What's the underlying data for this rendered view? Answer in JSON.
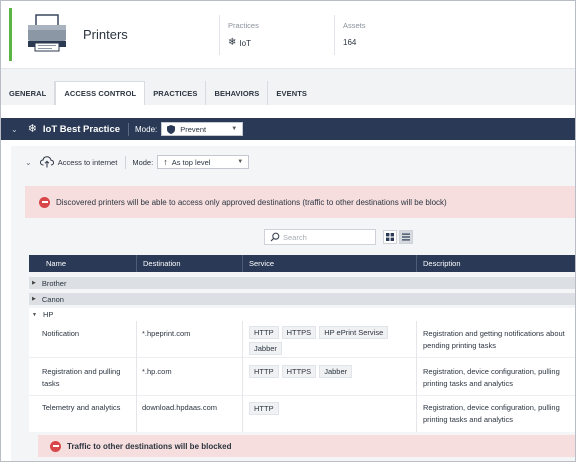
{
  "header": {
    "title": "Printers",
    "practices_label": "Practices",
    "practices_value": "IoT",
    "assets_label": "Assets",
    "assets_value": "164",
    "accent_color": "#5bb544"
  },
  "tabs": [
    {
      "label": "GENERAL",
      "active": false
    },
    {
      "label": "ACCESS CONTROL",
      "active": true
    },
    {
      "label": "PRACTICES",
      "active": false
    },
    {
      "label": "BEHAVIORS",
      "active": false
    },
    {
      "label": "EVENTS",
      "active": false
    }
  ],
  "practice": {
    "name": "IoT Best Practice",
    "mode_label": "Mode:",
    "mode_value": "Prevent",
    "bar_color": "#2a3a56"
  },
  "subsection": {
    "name": "Access to internet",
    "mode_label": "Mode:",
    "mode_value": "As top level"
  },
  "alert": {
    "text": "Discovered printers will be able to access only approved destinations (traffic to other destinations will be block)",
    "color": "#d9464a"
  },
  "search": {
    "placeholder": "Search"
  },
  "table": {
    "columns": [
      "Name",
      "Destination",
      "Service",
      "Description"
    ],
    "groups": [
      {
        "name": "Brother"
      },
      {
        "name": "Canon"
      },
      {
        "name": "HP"
      }
    ],
    "rows": [
      {
        "name": "Notification",
        "destination": "*.hpeprint.com",
        "services": [
          "HTTP",
          "HTTPS",
          "HP ePrint Servise",
          "Jabber"
        ],
        "description": "Registration and getting notifications about pending printing tasks"
      },
      {
        "name": "Registration and pulling tasks",
        "destination": "*.hp.com",
        "services": [
          "HTTP",
          "HTTPS",
          "Jabber"
        ],
        "description": "Registration, device configuration, pulling printing tasks and analytics"
      },
      {
        "name": "Telemetry and analytics",
        "destination": "download.hpdaas.com",
        "services": [
          "HTTP"
        ],
        "description": "Registration, device configuration, pulling printing tasks and analytics"
      }
    ]
  },
  "bottom_alert": {
    "text": "Traffic to other destinations will be blocked"
  }
}
